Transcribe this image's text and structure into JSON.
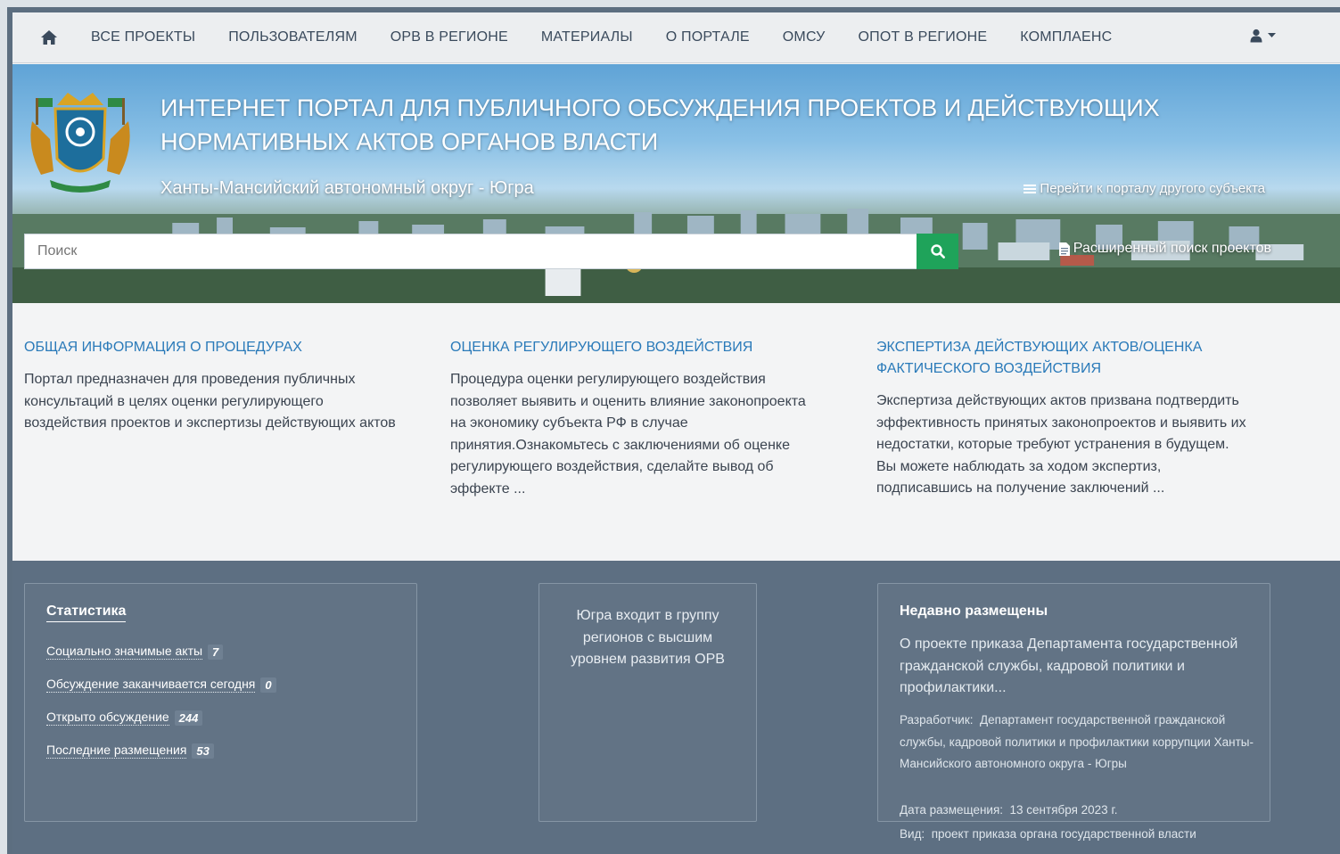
{
  "nav": {
    "items": [
      "ВСЕ ПРОЕКТЫ",
      "ПОЛЬЗОВАТЕЛЯМ",
      "ОРВ В РЕГИОНЕ",
      "МАТЕРИАЛЫ",
      "О ПОРТАЛЕ",
      "ОМСУ",
      "ОПОТ В РЕГИОНЕ",
      "КОМПЛАЕНС"
    ]
  },
  "banner": {
    "title": "ИНТЕРНЕТ ПОРТАЛ ДЛЯ ПУБЛИЧНОГО ОБСУЖДЕНИЯ ПРОЕКТОВ И ДЕЙСТВУЮЩИХ НОРМАТИВНЫХ АКТОВ ОРГАНОВ ВЛАСТИ",
    "region": "Ханты-Мансийский автономный округ - Югра",
    "other_portal": "Перейти к порталу другого субъекта",
    "search_placeholder": "Поиск",
    "advanced_search": "Расширенный поиск проектов"
  },
  "info": [
    {
      "title": "ОБЩАЯ ИНФОРМАЦИЯ О ПРОЦЕДУРАХ",
      "text": "Портал предназначен для проведения публичных консультаций в целях оценки регулирующего воздействия проектов и экспертизы действующих актов"
    },
    {
      "title": "ОЦЕНКА РЕГУЛИРУЮЩЕГО ВОЗДЕЙСТВИЯ",
      "text": "Процедура оценки регулирующего воздействия позволяет выявить и оценить влияние законопроекта на экономику субъекта РФ в случае принятия.Ознакомьтесь с заключениями об оценке регулирующего воздействия, сделайте вывод об эффекте ..."
    },
    {
      "title": "ЭКСПЕРТИЗА ДЕЙСТВУЮЩИХ АКТОВ/ОЦЕНКА ФАКТИЧЕСКОГО ВОЗДЕЙСТВИЯ",
      "text": "Экспертиза действующих актов призвана подтвердить эффективность принятых законопроектов и выявить их недостатки, которые требуют устранения в будущем. Вы можете наблюдать за ходом экспертиз, подписавшись на получение заключений ..."
    }
  ],
  "stats": {
    "title": "Статистика",
    "items": [
      {
        "label": "Социально значимые акты",
        "count": "7"
      },
      {
        "label": "Обсуждение заканчивается сегодня",
        "count": "0"
      },
      {
        "label": "Открыто обсуждение",
        "count": "244"
      },
      {
        "label": "Последние размещения",
        "count": "53"
      }
    ]
  },
  "orv_note": "Югра входит в группу регионов с высшим уровнем развития ОРВ",
  "recent": {
    "title": "Недавно размещены",
    "link": "О проекте приказа Департамента государственной гражданской службы, кадровой политики и профилактики...",
    "developer_label": "Разработчик:",
    "developer": "Департамент государственной гражданской службы, кадровой политики и профилактики коррупции Ханты-Мансийского автономного округа - Югры",
    "date_label": "Дата размещения:",
    "date": "13 сентября 2023 г.",
    "kind_label": "Вид:",
    "kind": "проект приказа органа государственной власти"
  },
  "colors": {
    "nav_bg": "#eceef0",
    "link_blue": "#2a7ab9",
    "search_green": "#1fa35a",
    "bottom_bg": "#5d6f82"
  }
}
